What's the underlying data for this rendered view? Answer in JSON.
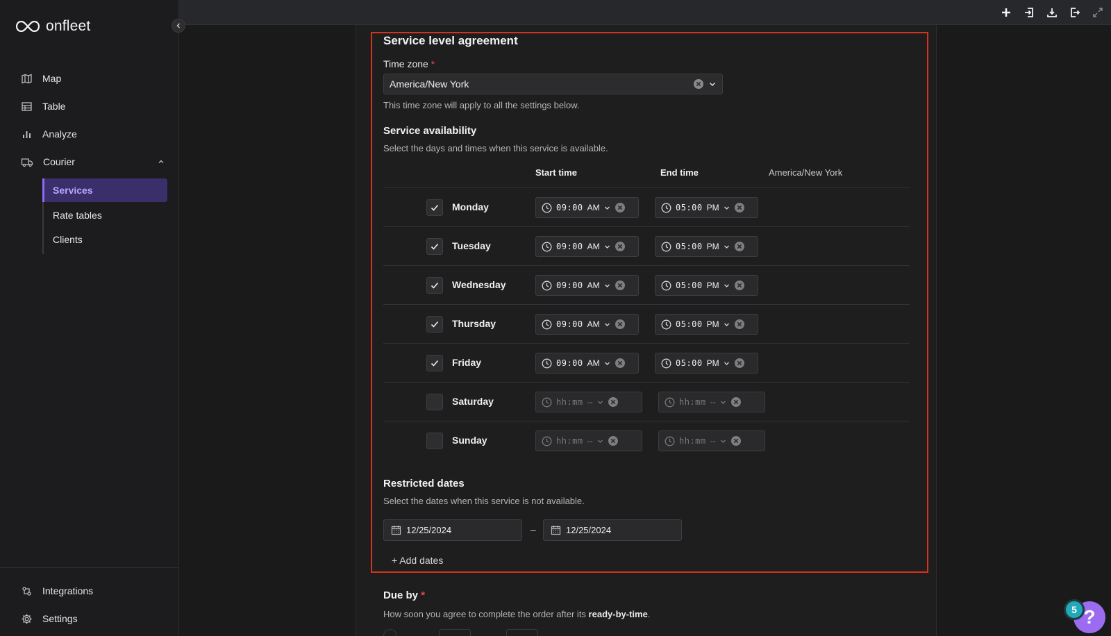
{
  "app": {
    "logo_text": "onfleet"
  },
  "sidebar": {
    "items": [
      {
        "label": "Map",
        "icon": "map-icon"
      },
      {
        "label": "Table",
        "icon": "table-icon"
      },
      {
        "label": "Analyze",
        "icon": "bar-chart-icon"
      },
      {
        "label": "Courier",
        "icon": "truck-icon"
      }
    ],
    "courier_sub": [
      {
        "label": "Services",
        "active": true
      },
      {
        "label": "Rate tables",
        "active": false
      },
      {
        "label": "Clients",
        "active": false
      }
    ],
    "bottom": [
      {
        "label": "Integrations",
        "icon": "integrations-icon"
      },
      {
        "label": "Settings",
        "icon": "gear-icon"
      }
    ]
  },
  "sla": {
    "title": "Service level agreement",
    "timezone_label": "Time zone",
    "required_mark": "*",
    "timezone_value": "America/New York",
    "timezone_hint": "This time zone will apply to all the settings below.",
    "availability_title": "Service availability",
    "availability_hint": "Select the days and times when this service is available.",
    "col_start": "Start time",
    "col_end": "End time",
    "col_tz": "America/New York",
    "days": [
      {
        "name": "Monday",
        "checked": true,
        "start": "09:00",
        "start_ampm": "AM",
        "end": "05:00",
        "end_ampm": "PM"
      },
      {
        "name": "Tuesday",
        "checked": true,
        "start": "09:00",
        "start_ampm": "AM",
        "end": "05:00",
        "end_ampm": "PM"
      },
      {
        "name": "Wednesday",
        "checked": true,
        "start": "09:00",
        "start_ampm": "AM",
        "end": "05:00",
        "end_ampm": "PM"
      },
      {
        "name": "Thursday",
        "checked": true,
        "start": "09:00",
        "start_ampm": "AM",
        "end": "05:00",
        "end_ampm": "PM"
      },
      {
        "name": "Friday",
        "checked": true,
        "start": "09:00",
        "start_ampm": "AM",
        "end": "05:00",
        "end_ampm": "PM"
      },
      {
        "name": "Saturday",
        "checked": false,
        "start": "hh:mm",
        "start_ampm": "--",
        "end": "hh:mm",
        "end_ampm": "--"
      },
      {
        "name": "Sunday",
        "checked": false,
        "start": "hh:mm",
        "start_ampm": "--",
        "end": "hh:mm",
        "end_ampm": "--"
      }
    ],
    "restricted_title": "Restricted dates",
    "restricted_hint": "Select the dates when this service is not available.",
    "date_from": "12/25/2024",
    "date_sep": "–",
    "date_to": "12/25/2024",
    "add_dates": "+ Add dates"
  },
  "due_by": {
    "title": "Due by",
    "required_mark": "*",
    "hint_prefix": "How soon you agree to complete the order after its ",
    "hint_bold": "ready-by-time",
    "hint_suffix": "."
  },
  "help": {
    "badge_count": "5",
    "button_label": "?"
  },
  "colors": {
    "accent": "#8b6cf2",
    "highlight_border": "#d6331f",
    "help": "#9b6cf0",
    "badge": "#22a8b8"
  }
}
